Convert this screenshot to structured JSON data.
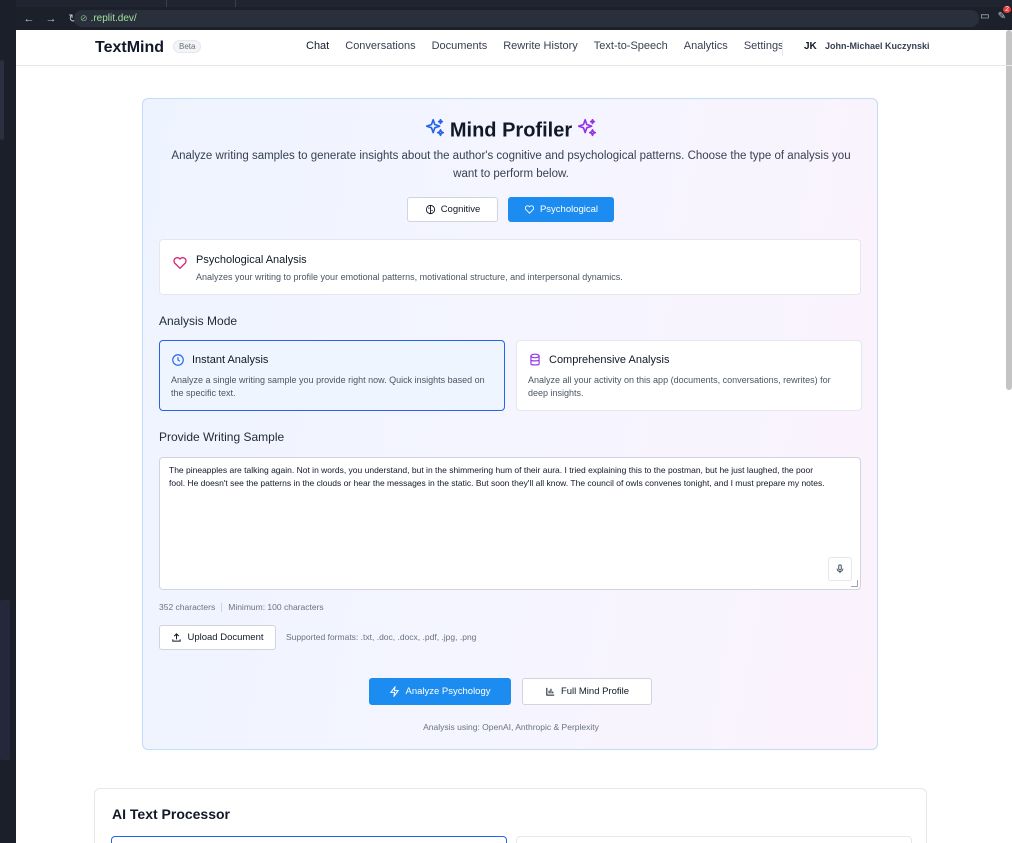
{
  "browser": {
    "url_prefix": ".replit.dev/",
    "back_icon": "back-arrow-icon",
    "forward_icon": "forward-arrow-icon",
    "reload_icon": "reload-icon",
    "extension_badge": "2"
  },
  "nav": {
    "brand": "TextMind",
    "badge": "Beta",
    "links": [
      "Chat",
      "Conversations",
      "Documents",
      "Rewrite History",
      "Text-to-Speech",
      "Analytics",
      "Settings"
    ],
    "active": "Chat",
    "user_initials": "JK",
    "user_name": "John-Michael Kuczynski"
  },
  "profiler": {
    "title": "Mind Profiler",
    "description": "Analyze writing samples to generate insights about the author's cognitive and psychological patterns. Choose the type of analysis you want to perform below.",
    "types": [
      {
        "label": "Cognitive",
        "icon": "brain-icon",
        "selected": false
      },
      {
        "label": "Psychological",
        "icon": "heart-icon",
        "selected": true
      }
    ],
    "info": {
      "title": "Psychological Analysis",
      "text": "Analyzes your writing to profile your emotional patterns, motivational structure, and interpersonal dynamics."
    },
    "mode_label": "Analysis Mode",
    "modes": [
      {
        "title": "Instant Analysis",
        "icon": "clock-icon",
        "text": "Analyze a single writing sample you provide right now. Quick insights based on the specific text.",
        "selected": true
      },
      {
        "title": "Comprehensive Analysis",
        "icon": "database-icon",
        "text": "Analyze all your activity on this app (documents, conversations, rewrites) for deep insights.",
        "selected": false
      }
    ],
    "sample_label": "Provide Writing Sample",
    "sample_text": "The pineapples are talking again. Not in words, you understand, but in the shimmering hum of their aura. I tried explaining this to the postman, but he just laughed, the poor fool. He doesn't see the patterns in the clouds or hear the messages in the static. But soon they'll all know. The council of owls convenes tonight, and I must prepare my notes.",
    "char_count": "352 characters",
    "minimum": "Minimum: 100 characters",
    "upload_label": "Upload Document",
    "formats": "Supported formats: .txt, .doc, .docx, .pdf, .jpg, .png",
    "analyze_label": "Analyze Psychology",
    "full_profile_label": "Full Mind Profile",
    "footer": "Analysis using: OpenAI, Anthropic & Perplexity"
  },
  "processor": {
    "title": "AI Text Processor"
  },
  "colors": {
    "primary": "#1d8cf0",
    "selected_border": "#2563eb",
    "heart": "#db2777",
    "sparkle_blue": "#2563eb",
    "sparkle_purple": "#9333ea"
  }
}
